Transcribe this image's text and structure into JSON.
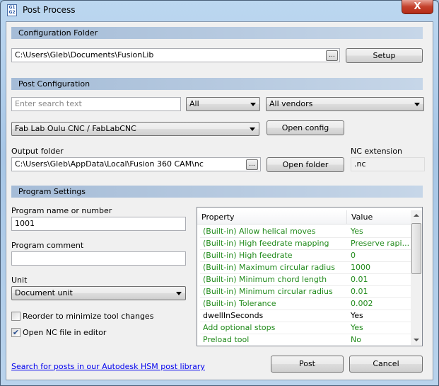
{
  "window": {
    "title": "Post Process",
    "close": "X",
    "icon": "G1G2"
  },
  "config_folder": {
    "header": "Configuration Folder",
    "path": "C:\\Users\\Gleb\\Documents\\FusionLib",
    "browse": "...",
    "setup": "Setup"
  },
  "post_config": {
    "header": "Post Configuration",
    "search_placeholder": "Enter search text",
    "filter": "All",
    "vendor": "All vendors",
    "post": "Fab Lab Oulu CNC / FabLabCNC",
    "open_config": "Open config",
    "output_label": "Output folder",
    "output_path": "C:\\Users\\Gleb\\AppData\\Local\\Fusion 360 CAM\\nc",
    "browse": "...",
    "open_folder": "Open folder",
    "nc_ext_label": "NC extension",
    "nc_ext": ".nc"
  },
  "program": {
    "header": "Program Settings",
    "name_label": "Program name or number",
    "name": "1001",
    "comment_label": "Program comment",
    "comment": "",
    "unit_label": "Unit",
    "unit": "Document unit",
    "reorder": "Reorder to minimize tool changes",
    "reorder_checked": false,
    "open_nc": "Open NC file in editor",
    "open_nc_checked": true
  },
  "properties": {
    "columns": [
      "Property",
      "Value"
    ],
    "rows": [
      {
        "property": "(Built-in) Allow helical moves",
        "value": "Yes",
        "modified": false
      },
      {
        "property": "(Built-in) High feedrate mapping",
        "value": "Preserve rapi...",
        "modified": false
      },
      {
        "property": "(Built-in) High feedrate",
        "value": "0",
        "modified": false
      },
      {
        "property": "(Built-in) Maximum circular radius",
        "value": "1000",
        "modified": false
      },
      {
        "property": "(Built-in) Minimum chord length",
        "value": "0.01",
        "modified": false
      },
      {
        "property": "(Built-in) Minimum circular radius",
        "value": "0.01",
        "modified": false
      },
      {
        "property": "(Built-in) Tolerance",
        "value": "0.002",
        "modified": false
      },
      {
        "property": "dwellInSeconds",
        "value": "Yes",
        "modified": true
      },
      {
        "property": "Add optional stops",
        "value": "Yes",
        "modified": false
      },
      {
        "property": "Preload tool",
        "value": "No",
        "modified": false
      }
    ],
    "default_color": "#208a1a"
  },
  "footer": {
    "link": "Search for posts in our Autodesk HSM post library",
    "post": "Post",
    "cancel": "Cancel"
  }
}
